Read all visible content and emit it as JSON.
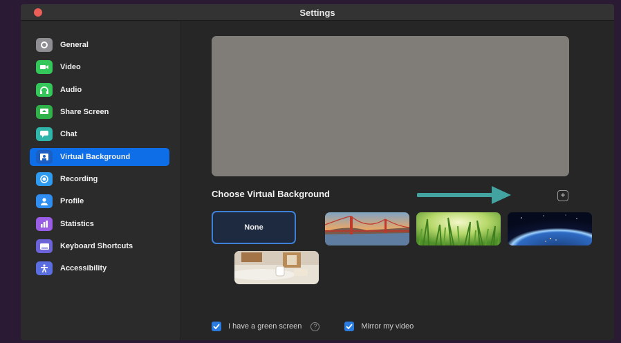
{
  "window": {
    "title": "Settings"
  },
  "sidebar": {
    "items": [
      {
        "label": "General",
        "icon": "gear-icon",
        "color": "#8e8e93",
        "active": false
      },
      {
        "label": "Video",
        "icon": "video-camera-icon",
        "color": "#34c759",
        "active": false
      },
      {
        "label": "Audio",
        "icon": "headphones-icon",
        "color": "#34c759",
        "active": false
      },
      {
        "label": "Share Screen",
        "icon": "share-screen-icon",
        "color": "#30b14a",
        "active": false
      },
      {
        "label": "Chat",
        "icon": "chat-bubble-icon",
        "color": "#2fb5a9",
        "active": false
      },
      {
        "label": "Virtual Background",
        "icon": "person-frame-icon",
        "color": "#1b5fc4",
        "active": true
      },
      {
        "label": "Recording",
        "icon": "record-icon",
        "color": "#2f9bf0",
        "active": false
      },
      {
        "label": "Profile",
        "icon": "person-icon",
        "color": "#2f8ef0",
        "active": false
      },
      {
        "label": "Statistics",
        "icon": "bar-chart-icon",
        "color": "#9b5de5",
        "active": false
      },
      {
        "label": "Keyboard Shortcuts",
        "icon": "keyboard-icon",
        "color": "#6c63d8",
        "active": false
      },
      {
        "label": "Accessibility",
        "icon": "accessibility-icon",
        "color": "#5b6ee1",
        "active": false
      }
    ]
  },
  "main": {
    "choose_title": "Choose Virtual Background",
    "add_button": "+",
    "backgrounds": [
      {
        "label": "None",
        "selected": true
      },
      {
        "label": "Golden Gate Bridge"
      },
      {
        "label": "Grass"
      },
      {
        "label": "Earth from space"
      },
      {
        "label": "Coffee table"
      }
    ],
    "green_screen_label": "I have a green screen",
    "help_glyph": "?",
    "mirror_label": "Mirror my video",
    "green_screen_checked": true,
    "mirror_checked": true
  },
  "colors": {
    "accent": "#0e6ee8",
    "arrow": "#43a3a0"
  }
}
